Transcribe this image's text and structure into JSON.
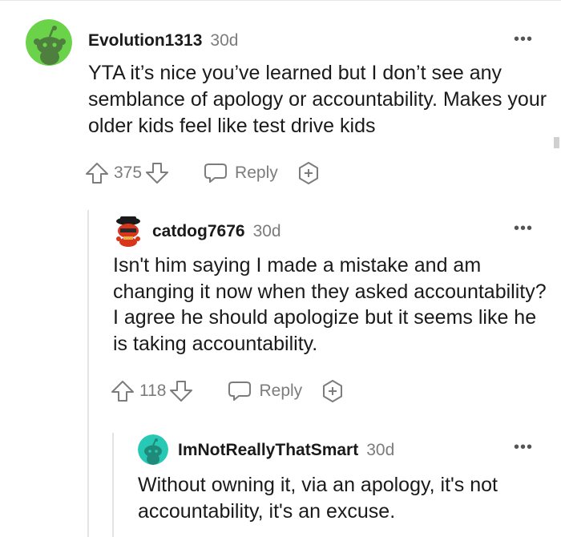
{
  "comments": [
    {
      "username": "Evolution1313",
      "age": "30d",
      "text": "YTA it’s nice you’ve learned but I don’t see any semblance of apology or accountability. Makes your older kids feel like test drive kids",
      "score": "375",
      "reply_label": "Reply",
      "more_label": "•••",
      "avatar_color": "#6ad34a"
    },
    {
      "username": "catdog7676",
      "age": "30d",
      "text": "Isn't him saying I made a mistake and am changing it now when they asked accountability? I agree he should apologize but it seems like he is taking accountability.",
      "score": "118",
      "reply_label": "Reply",
      "more_label": "•••",
      "avatar_color": "#d9351c"
    },
    {
      "username": "ImNotReallyThatSmart",
      "age": "30d",
      "text": "Without owning it, via an apology, it's not accountability, it's an excuse.",
      "more_label": "•••",
      "avatar_color": "#27c9b4"
    }
  ]
}
